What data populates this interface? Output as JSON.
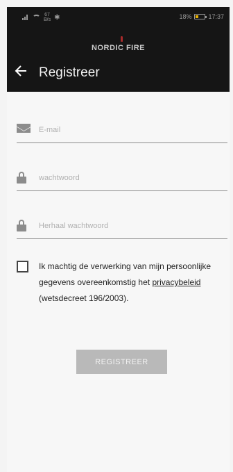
{
  "status_bar": {
    "network_speed": "67",
    "speed_unit": "B/s",
    "bluetooth_symbol": "✱",
    "battery_percent": "18%",
    "time": "17:37"
  },
  "header": {
    "brand": "NORDIC FIRE",
    "back_icon": "arrow-left-icon",
    "title": "Registreer"
  },
  "form": {
    "email": {
      "value": "",
      "placeholder": "E-mail",
      "icon": "mail-icon"
    },
    "password": {
      "value": "",
      "placeholder": "wachtwoord",
      "icon": "lock-icon"
    },
    "password_repeat": {
      "value": "",
      "placeholder": "Herhaal wachtwoord",
      "icon": "lock-icon"
    }
  },
  "consent": {
    "checked": false,
    "text_before": "Ik machtig de verwerking van mijn persoonlijke gegevens overeenkomstig het ",
    "link_text": "privacybeleid",
    "text_after": " (wetsdecreet 196/2003)."
  },
  "submit": {
    "label": "REGISTREER"
  },
  "colors": {
    "header_bg": "#151515",
    "page_bg": "#f7f7f7",
    "button_disabled": "#b9b9b9"
  }
}
